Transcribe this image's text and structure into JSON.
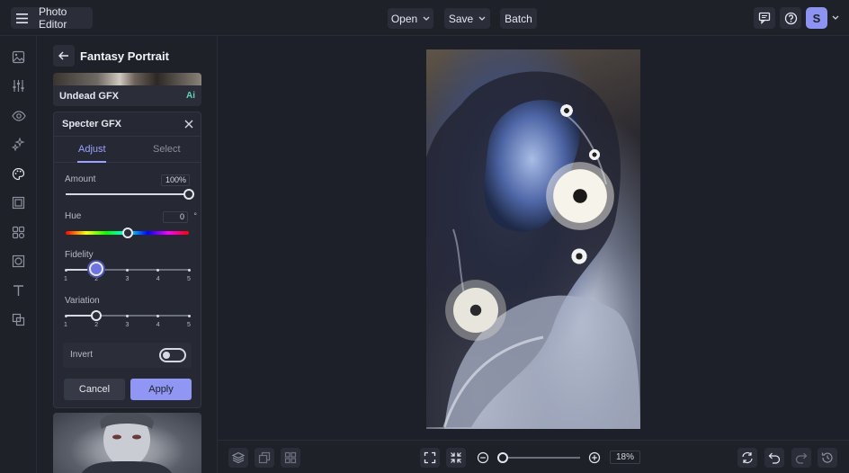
{
  "app": {
    "menu_icon": "hamburger-icon",
    "title": "Photo Editor"
  },
  "toolbar": {
    "open_label": "Open",
    "save_label": "Save",
    "batch_label": "Batch"
  },
  "header_icons": [
    "comment-icon",
    "help-icon"
  ],
  "user": {
    "initial": "S"
  },
  "rail_icons": [
    "image-icon",
    "adjust-sliders-icon",
    "eye-icon",
    "sparkle-effects-icon",
    "palette-artsy-icon",
    "frame-icon",
    "shapes-graphics-icon",
    "texture-overlay-icon",
    "text-icon",
    "layers-overlay-icon"
  ],
  "panel": {
    "title": "Fantasy Portrait",
    "prev_effect": {
      "label": "Undead GFX",
      "badge": "Ai"
    },
    "effect": {
      "title": "Specter GFX",
      "tabs": [
        {
          "label": "Adjust",
          "active": true
        },
        {
          "label": "Select",
          "active": false
        }
      ],
      "amount": {
        "label": "Amount",
        "value": "100%",
        "fraction": 1.0
      },
      "hue": {
        "label": "Hue",
        "value": "0",
        "unit": "°",
        "fraction": 0.5
      },
      "fidelity": {
        "label": "Fidelity",
        "steps": [
          "1",
          "2",
          "3",
          "4",
          "5"
        ],
        "selected": 2
      },
      "variation": {
        "label": "Variation",
        "steps": [
          "1",
          "2",
          "3",
          "4",
          "5"
        ],
        "selected": 2
      },
      "invert": {
        "label": "Invert",
        "on": false
      },
      "cancel_label": "Cancel",
      "apply_label": "Apply"
    }
  },
  "bottom": {
    "left_icons": [
      "layers-icon",
      "duplicate-icon",
      "grid-icon"
    ],
    "zoom": {
      "value": "18%",
      "fraction": 0.0
    },
    "right_icons": [
      "replace-image-icon",
      "undo-icon",
      "redo-icon",
      "history-icon"
    ]
  },
  "colors": {
    "accent": "#8f96f4",
    "background": "#1e2029",
    "panel": "#1f2129",
    "ai_badge": "#5fd3b4"
  }
}
